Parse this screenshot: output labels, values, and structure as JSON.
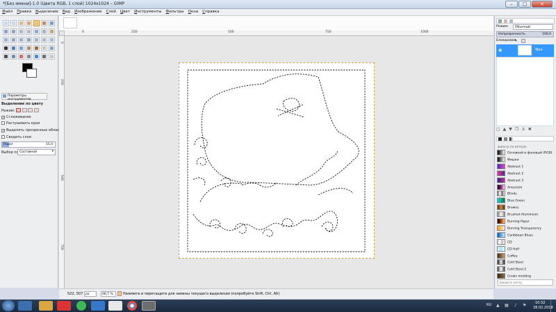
{
  "window": {
    "title": "*[Без имени]-1.0 (Цвета RGB, 1 слой) 1024x1024 – GIMP",
    "minimize": "–",
    "maximize": "□",
    "close": "×"
  },
  "menu": [
    "Файл",
    "Правка",
    "Выделение",
    "Вид",
    "Изображение",
    "Слой",
    "Цвет",
    "Инструменты",
    "Фильтры",
    "Окна",
    "Справка"
  ],
  "tool_options": {
    "tab_label": "Параметры инструментов",
    "title": "Выделение по цвету",
    "mode_label": "Режим:",
    "antialias": "Сглаживание",
    "feather": "Растушевать края",
    "select_transparent": "Выделять прозрачные области",
    "sample_merged": "Сводить слои",
    "threshold_label": "Порог",
    "threshold_value": "15,0",
    "select_by_label": "Выбор по",
    "select_by_value": "Составной"
  },
  "rulers": {
    "h": [
      "0",
      "250",
      "500",
      "750",
      "1000"
    ],
    "v": [
      "0",
      "250",
      "500",
      "750"
    ]
  },
  "layers": {
    "mode_label": "Режим:",
    "mode_value": "Обычный",
    "opacity_label": "Непрозрачность",
    "opacity_value": "100,0",
    "lock_label": "Блокировка:",
    "layer_name": "Фон"
  },
  "gradients": {
    "filter_label": "фильтр по меткам",
    "items": [
      "Основной в фоновый (RGB)",
      "Фишки",
      "Abstract 1",
      "Abstract 2",
      "Abstract 3",
      "Aneurism",
      "Blinds",
      "Blue Green",
      "Browns",
      "Brushed Aluminium",
      "Burning Paper",
      "Burning Transparency",
      "Caribbean Blues",
      "CD",
      "CD Half",
      "Coffee",
      "Cold Steel",
      "Cold Steel 2",
      "Crown molding"
    ],
    "colors": [
      "linear-gradient(90deg,#000,#fff)",
      "linear-gradient(90deg,#000,#fff)",
      "linear-gradient(90deg,#3a2fd8,#ff3fa0)",
      "linear-gradient(90deg,#e63a8f,#4b2aa0)",
      "linear-gradient(90deg,#1f2a8a,#e21f8e)",
      "linear-gradient(90deg,#0b0b0b,#9a1a8c,#eee)",
      "linear-gradient(90deg,#666,#fff,#666,#fff)",
      "linear-gradient(90deg,#1ad0e8,#0a7f2c)",
      "linear-gradient(90deg,#5b3110,#c88a3a,#5b3110)",
      "linear-gradient(90deg,#888,#fafafa,#888)",
      "linear-gradient(90deg,#000,#b43b06,#ffcf6e)",
      "linear-gradient(90deg,#ff9a1a,#fff0)",
      "linear-gradient(90deg,#0a5cc0,#c2efff)",
      "linear-gradient(90deg,#ccc,#fff,#bbb,#fff)",
      "linear-gradient(90deg,#eee,#9ae3ff,#fff)",
      "linear-gradient(90deg,#4b2a0d,#c9a36f)",
      "linear-gradient(90deg,#222,#eee,#222)",
      "linear-gradient(90deg,#444,#fff,#444)",
      "linear-gradient(90deg,#3b2410,#8a6d44)"
    ],
    "footer_label": "введите метку"
  },
  "status": {
    "coords": "522, 507",
    "unit": "px",
    "zoom": "66,7 %",
    "message": "Нажмите и перетащите для замены текущего выделения (попробуйте Shift, Ctrl, Alt)"
  },
  "taskbar": {
    "lang": "RU",
    "time": "10:32",
    "date": "28.02.2018"
  }
}
